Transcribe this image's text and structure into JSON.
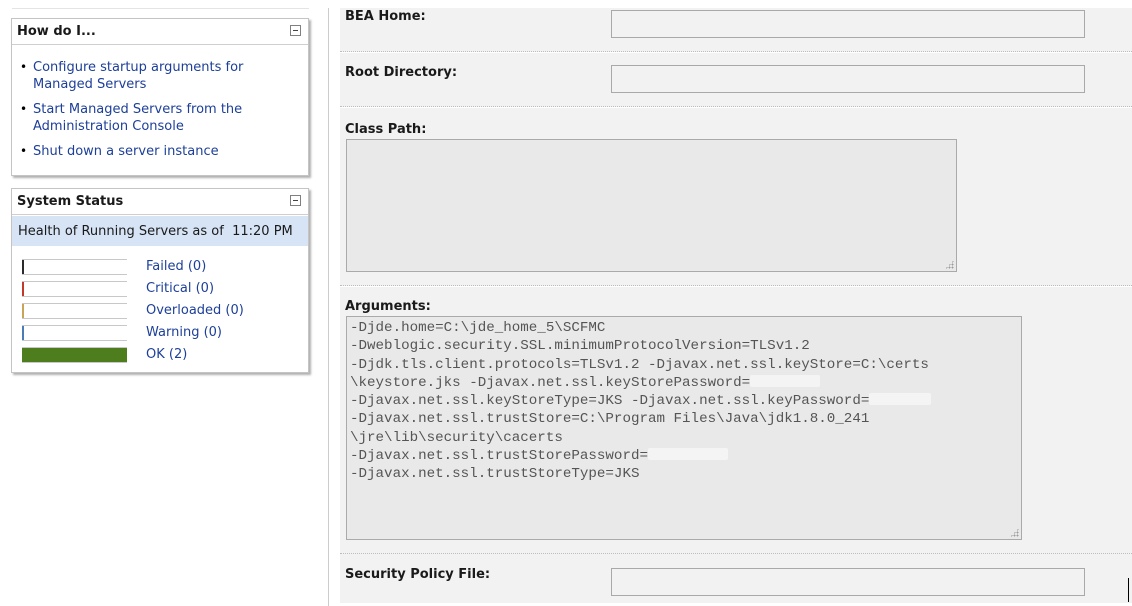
{
  "how_do_i": {
    "title": "How do I...",
    "links": [
      "Configure startup arguments for Managed Servers",
      "Start Managed Servers from the Administration Console",
      "Shut down a server instance"
    ]
  },
  "system_status": {
    "title": "System Status",
    "health_heading": "Health of Running Servers as of",
    "time": "11:20 PM",
    "rows": [
      {
        "label": "Failed (0)",
        "count": 0,
        "color": "#2b2b2b"
      },
      {
        "label": "Critical (0)",
        "count": 0,
        "color": "#c0392b"
      },
      {
        "label": "Overloaded (0)",
        "count": 0,
        "color": "#c8a35a"
      },
      {
        "label": "Warning (0)",
        "count": 0,
        "color": "#4a7db5"
      },
      {
        "label": "OK (2)",
        "count": 2,
        "fill_fraction": 1.0,
        "color": "#4e7d1e"
      }
    ]
  },
  "form": {
    "bea_home": {
      "label": "BEA Home:",
      "value": ""
    },
    "root_directory": {
      "label": "Root Directory:",
      "value": ""
    },
    "class_path": {
      "label": "Class Path:",
      "value": ""
    },
    "arguments": {
      "label": "Arguments:",
      "lines": [
        "-Djde.home=C:\\jde_home_5\\SCFMC",
        "-Dweblogic.security.SSL.minimumProtocolVersion=TLSv1.2",
        "-Djdk.tls.client.protocols=TLSv1.2 -Djavax.net.ssl.keyStore=C:\\certs",
        "\\keystore.jks -Djavax.net.ssl.keyStorePassword=",
        "-Djavax.net.ssl.keyStoreType=JKS -Djavax.net.ssl.keyPassword=",
        "-Djavax.net.ssl.trustStore=C:\\Program Files\\Java\\jdk1.8.0_241",
        "\\jre\\lib\\security\\cacerts",
        "-Djavax.net.ssl.trustStorePassword=",
        "-Djavax.net.ssl.trustStoreType=JKS"
      ]
    },
    "security_policy_file": {
      "label": "Security Policy File:",
      "value": ""
    }
  }
}
